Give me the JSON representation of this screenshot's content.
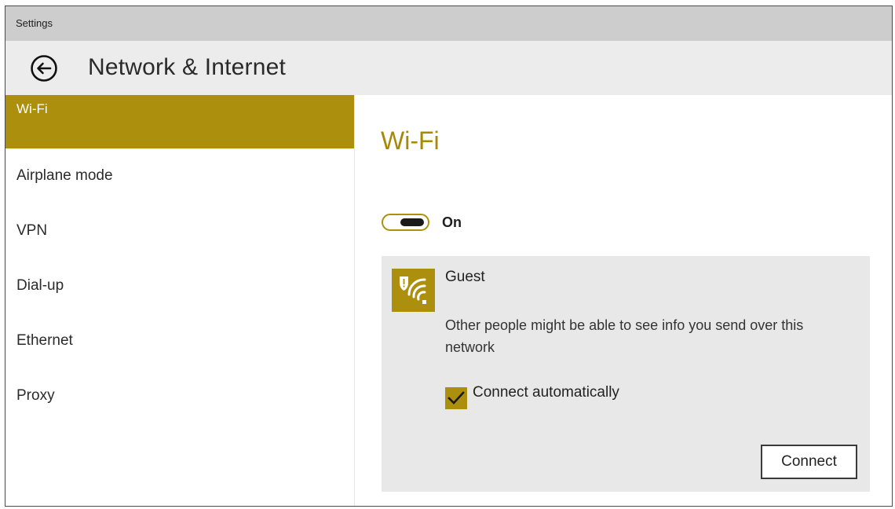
{
  "window": {
    "title": "Settings"
  },
  "header": {
    "title": "Network & Internet",
    "back_icon": "back-arrow-icon"
  },
  "sidebar": {
    "items": [
      {
        "label": "Wi-Fi",
        "selected": true
      },
      {
        "label": "Airplane mode",
        "selected": false
      },
      {
        "label": "VPN",
        "selected": false
      },
      {
        "label": "Dial-up",
        "selected": false
      },
      {
        "label": "Ethernet",
        "selected": false
      },
      {
        "label": "Proxy",
        "selected": false
      }
    ]
  },
  "content": {
    "title": "Wi-Fi",
    "wifi_toggle": {
      "state": "On",
      "on": true
    },
    "network": {
      "name": "Guest",
      "icon": "wifi-warning-icon",
      "warning": "Other people might be able to see info you send over this network",
      "connect_automatically": {
        "label": "Connect automatically",
        "checked": true
      },
      "connect_button": "Connect"
    }
  },
  "colors": {
    "accent": "#ac8f0c",
    "titlebar": "#cdcdcd",
    "header": "#ececec",
    "card": "#e8e8e8"
  }
}
